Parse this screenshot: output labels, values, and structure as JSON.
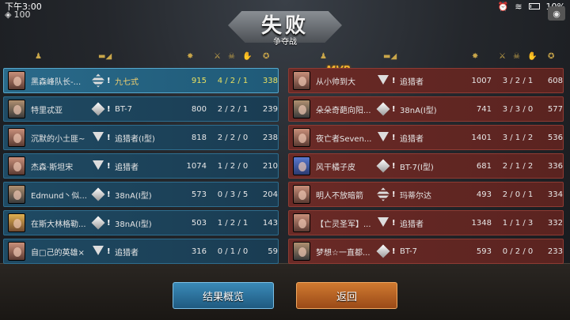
{
  "status_bar": {
    "time": "下午3:00",
    "battery": "10%"
  },
  "header": {
    "currency": "100",
    "result": "失败",
    "mode": "争夺战",
    "mvp": "MVP"
  },
  "columns": {
    "damage_icon": "explosion-icon",
    "kill_icon": "sword-icon",
    "death_icon": "skull-icon",
    "assist_icon": "hand-icon",
    "score_icon": "star-icon"
  },
  "blue_team": [
    {
      "name": "黑森峰队长-...",
      "rank": "stripe",
      "tank": "九七式",
      "damage": "915",
      "kda": "4 / 2 / 1",
      "score": "338"
    },
    {
      "name": "特里忒亚",
      "rank": "diamond",
      "tank": "BT-7",
      "damage": "800",
      "kda": "2 / 2 / 1",
      "score": "239"
    },
    {
      "name": "沉默的小土匪~",
      "rank": "tri",
      "tank": "追猎者(I型)",
      "damage": "818",
      "kda": "2 / 2 / 0",
      "score": "238"
    },
    {
      "name": "杰森·斯坦宋",
      "rank": "tri",
      "tank": "追猎者",
      "damage": "1074",
      "kda": "1 / 2 / 0",
      "score": "210"
    },
    {
      "name": "Edmund丶似...",
      "rank": "diamond",
      "tank": "38nA(I型)",
      "damage": "573",
      "kda": "0 / 3 / 5",
      "score": "204"
    },
    {
      "name": "在斯大林格勒...",
      "rank": "diamond",
      "tank": "38nA(I型)",
      "damage": "503",
      "kda": "1 / 2 / 1",
      "score": "143"
    },
    {
      "name": "自□己的英雄×",
      "rank": "tri",
      "tank": "追猎者",
      "damage": "316",
      "kda": "0 / 1 / 0",
      "score": "59"
    }
  ],
  "red_team": [
    {
      "name": "从小帅到大",
      "rank": "tri",
      "tank": "追猎者",
      "damage": "1007",
      "kda": "3 / 2 / 1",
      "score": "608"
    },
    {
      "name": "朵朵奇葩向阳...",
      "rank": "diamond",
      "tank": "38nA(I型)",
      "damage": "741",
      "kda": "3 / 3 / 0",
      "score": "577"
    },
    {
      "name": "夜亡者Seven...",
      "rank": "tri",
      "tank": "追猎者",
      "damage": "1401",
      "kda": "3 / 1 / 2",
      "score": "536"
    },
    {
      "name": "风干橘子皮",
      "rank": "diamond",
      "tank": "BT-7(I型)",
      "damage": "681",
      "kda": "2 / 1 / 2",
      "score": "336"
    },
    {
      "name": "明人不放暗箭",
      "rank": "stripe",
      "tank": "玛蒂尔达",
      "damage": "493",
      "kda": "2 / 0 / 1",
      "score": "334"
    },
    {
      "name": "【亡灵圣军】...",
      "rank": "tri",
      "tank": "追猎者",
      "damage": "1348",
      "kda": "1 / 1 / 3",
      "score": "332"
    },
    {
      "name": "梦想☆一直都...",
      "rank": "diamond",
      "tank": "BT-7",
      "damage": "593",
      "kda": "0 / 2 / 0",
      "score": "233"
    }
  ],
  "buttons": {
    "summary": "结果概览",
    "back": "返回"
  }
}
